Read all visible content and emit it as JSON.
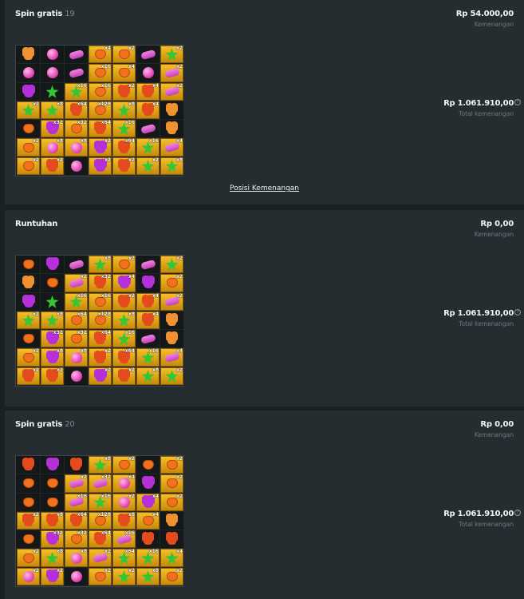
{
  "currency_prefix": "Rp",
  "panels": [
    {
      "title": "Spin gratis",
      "spin_number": "19",
      "win_amount": "Rp 54.000,00",
      "win_label": "Kemenangan",
      "total_amount": "Rp 1.061.910,00",
      "total_label": "Total kemenangan",
      "link": "Posisi Kemenangan",
      "grid": [
        [
          "bear-o",
          "ball",
          "bean",
          "g-heart:x4",
          "g-heart:x2",
          "bean",
          "g-star:x2"
        ],
        [
          "ball",
          "ball",
          "bean",
          "g-heart:x16",
          "g-heart:x4",
          "ball",
          "g-bean:x2"
        ],
        [
          "grape",
          "star",
          "g-star:x16",
          "g-heart:x16",
          "g-bear:x2",
          "g-bear:x4",
          "g-bean:x2"
        ],
        [
          "g-star:x2",
          "g-star:x8",
          "g-bear:x64",
          "g-heart:x128",
          "g-star:x8",
          "g-bear:x4",
          "bear-o"
        ],
        [
          "heart",
          "g-grape:x32",
          "g-heart:x32",
          "g-bear:x64",
          "g-star:x16",
          "bean",
          "bear-o"
        ],
        [
          "g-heart:x2",
          "g-ball:x8",
          "g-ball:x8",
          "g-grape:x2",
          "g-bear:x64",
          "g-star:x16",
          "g-bean:x4"
        ],
        [
          "g-heart:x2",
          "g-bear:x2",
          "ball",
          "g-grape:x2",
          "g-bear:x2",
          "g-star:x2",
          "g-star:x8"
        ]
      ]
    },
    {
      "title": "Runtuhan",
      "spin_number": "",
      "win_amount": "Rp 0,00",
      "win_label": "Kemenangan",
      "total_amount": "Rp 1.061.910,00",
      "total_label": "Total kemenangan",
      "grid": [
        [
          "heart",
          "grape",
          "bean",
          "g-star:x8",
          "g-heart:x2",
          "bean",
          "g-star:x2"
        ],
        [
          "bear-o",
          "heart",
          "g-bean:x2",
          "g-bear:x32",
          "g-grape:x4",
          "grape",
          "g-heart:x2"
        ],
        [
          "grape",
          "star",
          "g-star:x16",
          "g-heart:x16",
          "g-bear:x2",
          "g-bear:x4",
          "g-bean:x2"
        ],
        [
          "g-star:x2",
          "g-star:x8",
          "g-heart:x64",
          "g-heart:x128",
          "g-star:x8",
          "g-bear:x4",
          "bear-o"
        ],
        [
          "heart",
          "g-grape:x32",
          "g-heart:x32",
          "g-bear:x64",
          "g-star:x16",
          "bean",
          "bear-o"
        ],
        [
          "g-heart:x2",
          "g-grape:x8",
          "g-ball:x8",
          "g-bear:x2",
          "g-bear:x64",
          "g-star:x16",
          "g-bean:x4"
        ],
        [
          "g-bear:x2",
          "g-bear:x2",
          "ball",
          "g-grape:x2",
          "g-bear:x2",
          "g-star:x8",
          "g-star:x2"
        ]
      ]
    },
    {
      "title": "Spin gratis",
      "spin_number": "20",
      "win_amount": "Rp 0,00",
      "win_label": "Kemenangan",
      "total_amount": "Rp 1.061.910,00",
      "total_label": "Total kemenangan",
      "grid": [
        [
          "bear",
          "grape",
          "bear",
          "g-star:x8",
          "g-heart:x2",
          "heart",
          "g-heart:x2"
        ],
        [
          "heart",
          "heart",
          "g-bean:x2",
          "g-bean:x32",
          "g-ball:x4",
          "grape",
          "g-heart:x2"
        ],
        [
          "heart",
          "heart",
          "g-bean:x16",
          "g-star:x16",
          "g-ball:x2",
          "g-grape:x4",
          "g-heart:x2"
        ],
        [
          "g-bear:x2",
          "g-bear:x8",
          "g-bear:x64",
          "g-heart:x128",
          "g-bear:x8",
          "g-heart:x4",
          "bear-o"
        ],
        [
          "heart",
          "g-grape:x32",
          "g-heart:x32",
          "g-bear:x64",
          "g-bean:x16",
          "bear",
          "bear"
        ],
        [
          "g-heart:x2",
          "g-star:x8",
          "g-ball:x8",
          "g-bean:x2",
          "g-star:x64",
          "g-star:x16",
          "g-star:x4"
        ],
        [
          "g-ball:x2",
          "g-grape:x2",
          "ball",
          "g-heart:x2",
          "g-star:x2",
          "g-star:x8",
          "g-heart:x2"
        ]
      ]
    }
  ]
}
